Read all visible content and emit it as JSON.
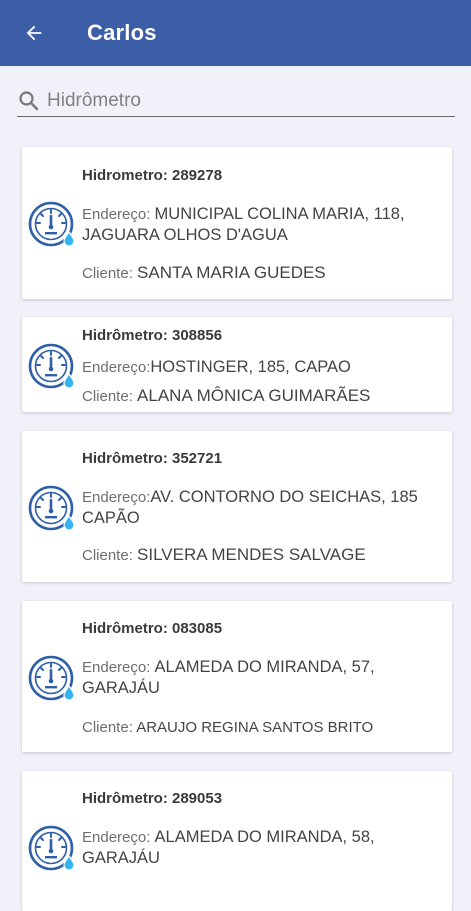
{
  "appbar": {
    "title": "Carlos",
    "back_icon": "arrow-left-icon",
    "color": "#3b5ea6"
  },
  "search": {
    "placeholder": "Hidrômetro",
    "value": "",
    "icon": "search-icon"
  },
  "cards": [
    {
      "hidrometro": "Hidrometro: 289278",
      "address_label": "Endereço: ",
      "address": "MUNICIPAL COLINA MARIA, 118, JAGUARA OLHOS D'AGUA",
      "client_label": "Cliente: ",
      "client": "SANTA MARIA GUEDES"
    },
    {
      "hidrometro": "Hidrômetro: 308856",
      "address_label": "Endereço:",
      "address": "HOSTINGER, 185, CAPAO",
      "client_label": "Cliente: ",
      "client": "ALANA MÔNICA GUIMARÃES"
    },
    {
      "hidrometro": "Hidrômetro: 352721",
      "address_label": "Endereço:",
      "address": "AV. CONTORNO DO SEICHAS, 185 CAPÃO",
      "client_label": "Cliente: ",
      "client": "SILVERA MENDES SALVAGE"
    },
    {
      "hidrometro": "Hidrômetro: 083085",
      "address_label": "Endereço:  ",
      "address": "ALAMEDA DO MIRANDA, 57, GARAJÁU",
      "client_label": "Cliente: ",
      "client": "ARAUJO REGINA SANTOS BRITO"
    },
    {
      "hidrometro": "Hidrômetro: 289053",
      "address_label": "Endereço:  ",
      "address": "ALAMEDA DO MIRANDA, 58, GARAJÁU",
      "client_label": "",
      "client": ""
    }
  ],
  "colors": {
    "background": "#f1f1f9",
    "icon_blue": "#2f5fa6",
    "drop_blue": "#35b3f0"
  }
}
